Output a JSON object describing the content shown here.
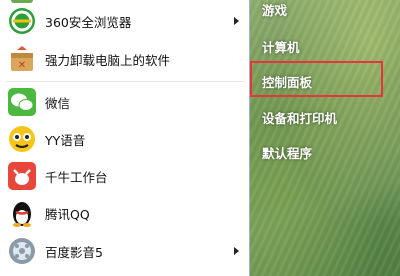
{
  "left_programs": [
    {
      "label": "360安全浏览器",
      "icon": "360-browser-icon",
      "has_submenu": true
    },
    {
      "label": "强力卸载电脑上的软件",
      "icon": "uninstall-box-icon",
      "has_submenu": false
    },
    {
      "label": "微信",
      "icon": "wechat-icon",
      "has_submenu": false
    },
    {
      "label": "YY语音",
      "icon": "yy-voice-icon",
      "has_submenu": false
    },
    {
      "label": "千牛工作台",
      "icon": "qianniu-icon",
      "has_submenu": false
    },
    {
      "label": "腾讯QQ",
      "icon": "qq-penguin-icon",
      "has_submenu": false
    },
    {
      "label": "百度影音5",
      "icon": "baidu-video-icon",
      "has_submenu": true
    }
  ],
  "right_items": [
    {
      "label": "游戏"
    },
    {
      "label": "计算机"
    },
    {
      "label": "控制面板",
      "highlighted": true
    },
    {
      "label": "设备和打印机"
    },
    {
      "label": "默认程序"
    }
  ],
  "colors": {
    "highlight_border": "#e8343b",
    "pane_bg": "#ffffff",
    "aero_green": "#6f9456"
  }
}
